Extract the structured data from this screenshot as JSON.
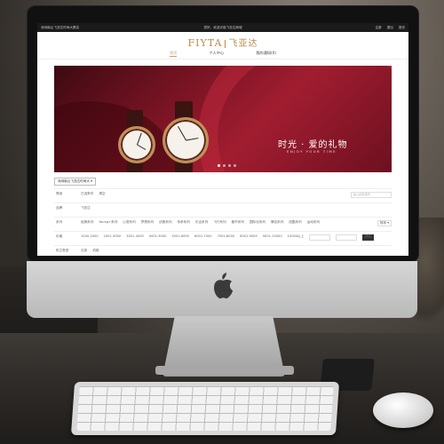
{
  "topbar": {
    "left_text": "深圳南山飞亚达时间大厦店",
    "center_text": "您好，欢迎光临飞亚达商城",
    "right_items": [
      "注册",
      "退出",
      "首页"
    ]
  },
  "brand": {
    "logo_en": "FIYTA",
    "logo_cn": "飞亚达",
    "accent_color": "#b88a4a"
  },
  "nav": {
    "items": [
      {
        "label": "首页",
        "active": true
      },
      {
        "label": "个人中心",
        "active": false
      },
      {
        "label": "我的通知(0)",
        "active": false
      }
    ]
  },
  "banner": {
    "slogan_cn": "时光 · 爱的礼物",
    "slogan_en": "ENJOY YOUR TIME",
    "primary_color": "#8a1426"
  },
  "filters": {
    "store_select": "深圳南山飞亚达时间大 ▾",
    "rows": [
      {
        "label": "筛选",
        "values": [
          "已选条件",
          "清空"
        ],
        "extra": "输入名称/型号"
      },
      {
        "label": "品牌",
        "values": [
          "飞亚达"
        ]
      },
      {
        "label": "系列",
        "values": [
          "经典系列",
          "Young+系列",
          "心语系列",
          "梦想系列",
          "优雅系列",
          "传承系列",
          "乐活系列",
          "飞行系列",
          "都市系列",
          "国际化系列",
          "情侣系列",
          "炫酷系列",
          "运动系列"
        ],
        "extra": "排序 ▾"
      },
      {
        "label": "价格",
        "values": [
          "1000-2000",
          "2001-3000",
          "3001-4000",
          "4001-5000",
          "5001-6000",
          "6001-7000",
          "7001-8000",
          "8001-9000",
          "9001-10000",
          "10000以上"
        ],
        "extra": "确定"
      },
      {
        "label": "机芯类型",
        "values": [
          "石英",
          "机械"
        ]
      }
    ]
  }
}
